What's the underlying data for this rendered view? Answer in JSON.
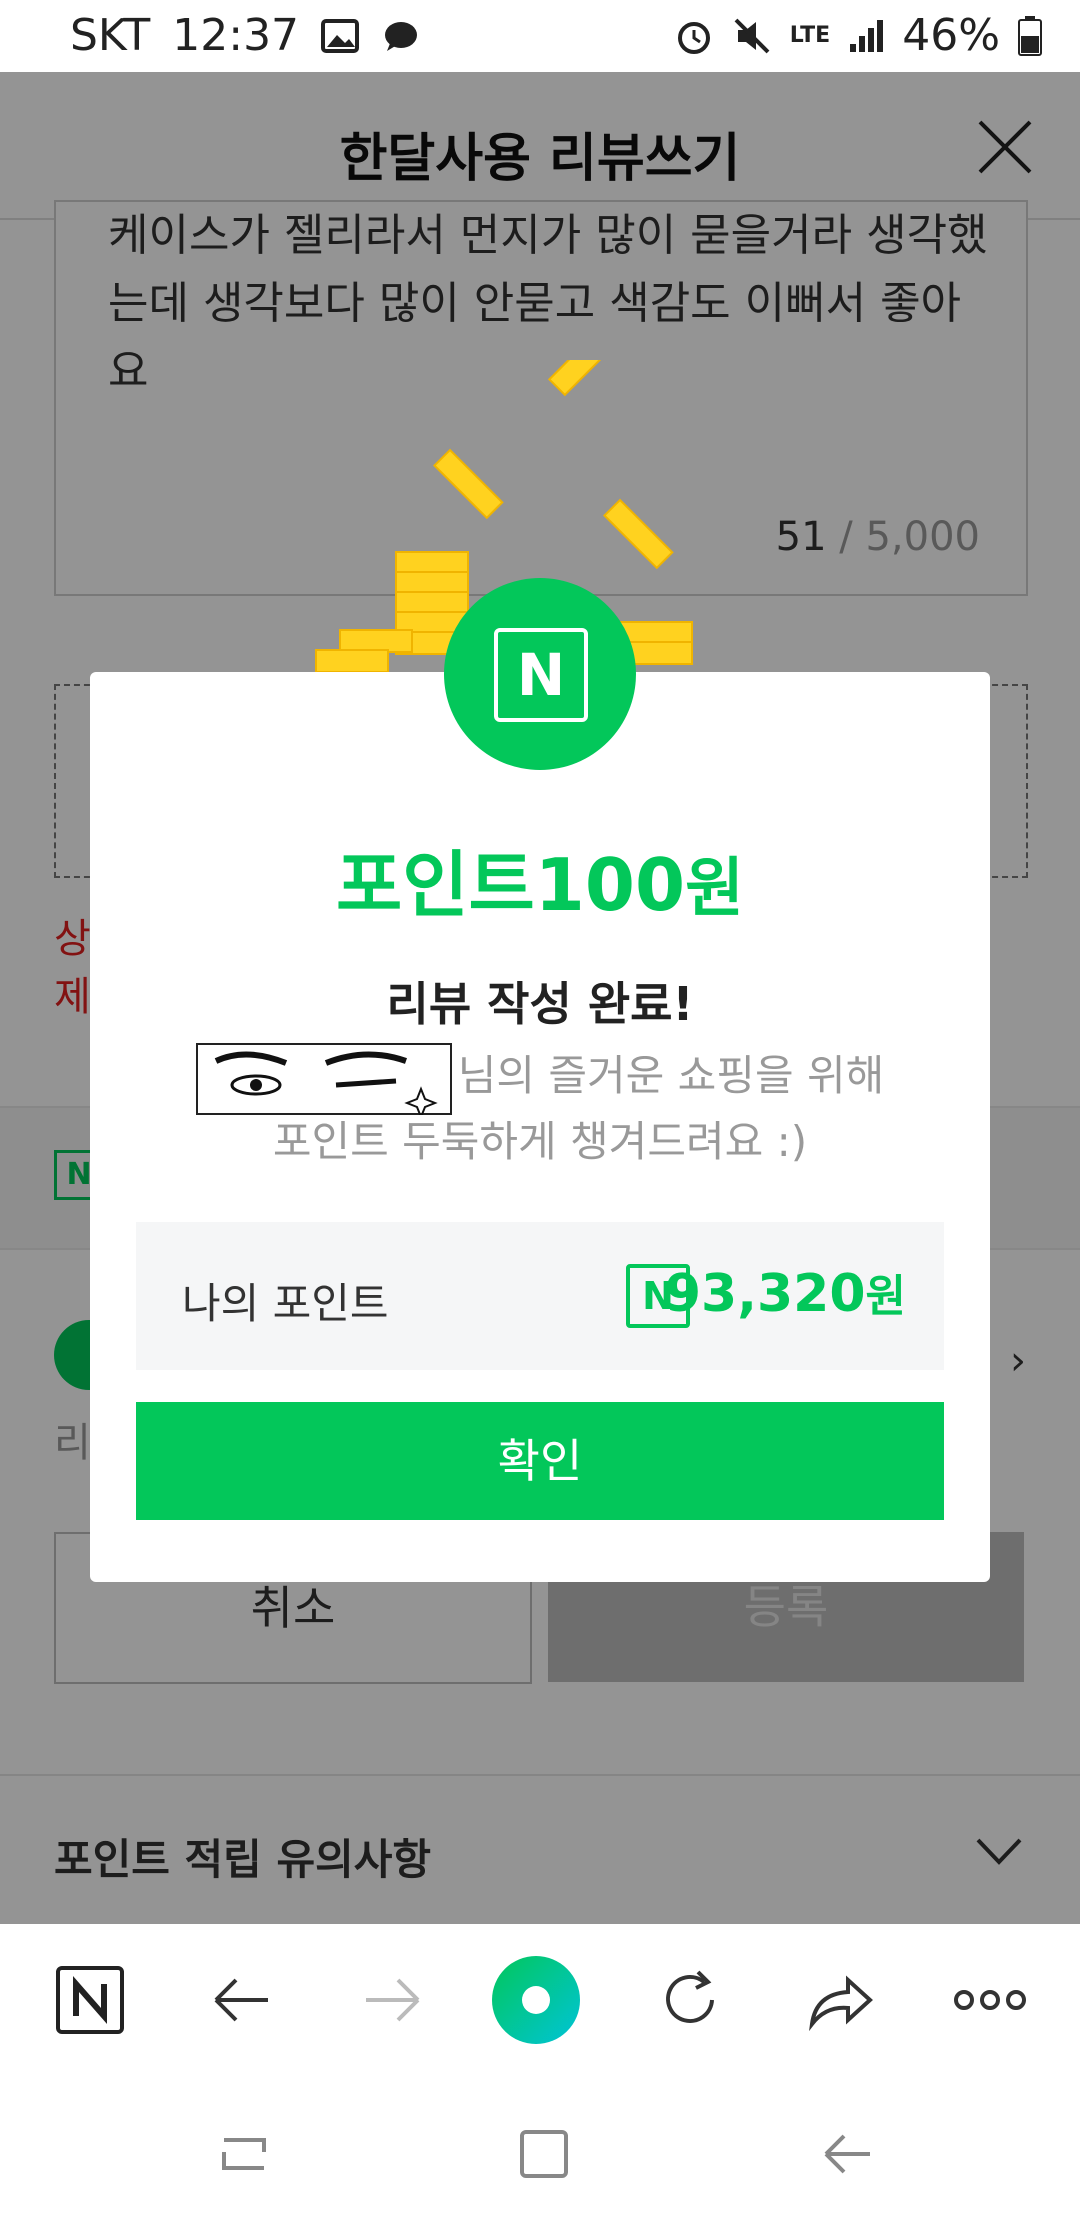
{
  "status_bar": {
    "carrier": "SKT",
    "time": "12:37",
    "network": "LTE",
    "battery": "46%"
  },
  "header": {
    "title": "한달사용 리뷰쓰기"
  },
  "review": {
    "text": "케이스가 젤리라서 먼지가 많이 묻을거라 생각했는데 생각보다 많이 안묻고 색감도 이뻐서 좋아요",
    "count": "51",
    "separator": "/",
    "max": "5,000"
  },
  "warning": {
    "line1": "상",
    "line2": "제"
  },
  "promo": {
    "text": "리"
  },
  "buttons": {
    "cancel": "취소",
    "register": "등록"
  },
  "notice": {
    "label": "포인트 적립 유의사항"
  },
  "dialog": {
    "badge_letter": "N",
    "points_amount": "포인트100",
    "points_unit": "원",
    "done_title": "리뷰 작성 완료!",
    "message_line1": "님의 즐거운 쇼핑을 위해",
    "message_line2": "포인트 두둑하게 챙겨드려요 :)",
    "my_points_label": "나의 포인트",
    "my_points_value": "93,320",
    "my_points_unit": "원",
    "confirm": "확인"
  },
  "colors": {
    "accent": "#03c75a",
    "warning": "#e02020",
    "coin": "#ffd21f"
  }
}
